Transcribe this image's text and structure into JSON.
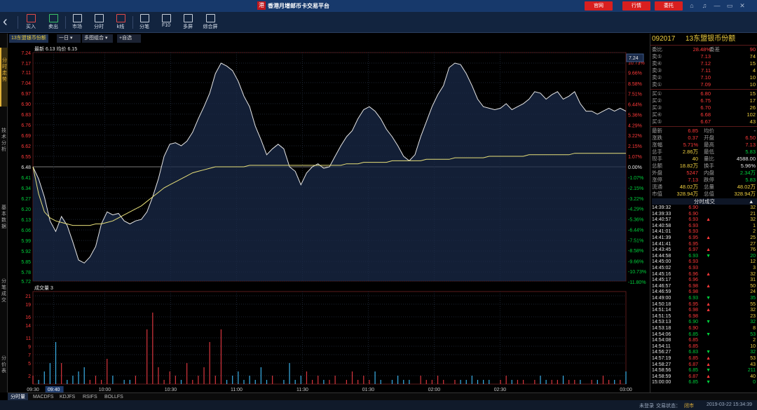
{
  "titlebar": {
    "logo_text": "港",
    "title": "香港月增邮币卡交易平台",
    "buttons": [
      "官网",
      "行情",
      "委托"
    ],
    "win_controls": [
      "⌂",
      "♫",
      "—",
      "▭",
      "✕"
    ]
  },
  "toolbar": {
    "items": [
      {
        "label": "买入",
        "icon": "buy-icon"
      },
      {
        "label": "卖出",
        "icon": "sell-icon"
      },
      {
        "label": "市场",
        "icon": "market-icon"
      },
      {
        "label": "分时",
        "icon": "timeshare-icon"
      },
      {
        "label": "k线",
        "icon": "kline-icon"
      },
      {
        "label": "分笔",
        "icon": "tick-icon"
      },
      {
        "label": "F10",
        "icon": "f10-icon"
      },
      {
        "label": "多屏",
        "icon": "multiscreen-icon"
      },
      {
        "label": "综合屏",
        "icon": "dashboard-icon"
      }
    ]
  },
  "left_tabs": [
    "分时走势",
    "技术分析",
    "基本数据",
    "分笔成交",
    "分价表"
  ],
  "chart_header": {
    "stock_tab": "13东盟银币份额",
    "period": "一日",
    "combo": "多图组合",
    "add_fav": "+自选",
    "info": "最新 6.13  均价 6.15"
  },
  "volume_label": "成交量 3",
  "bottom_tabs": [
    "分时量",
    "MACDFS",
    "KDJFS",
    "RSIFS",
    "BOLLFS"
  ],
  "status": {
    "left": "未登录",
    "trade_state": "交易状态：",
    "closed": "闭市",
    "datetime": "2019-03-22 15:34:39"
  },
  "quote": {
    "code": "092017",
    "name": "13东盟银币份额",
    "weibi": {
      "label": "委比",
      "value": "28.48%",
      "label2": "委差",
      "value2": "90"
    },
    "asks": [
      {
        "label": "卖⑤",
        "price": "7.13",
        "vol": "74"
      },
      {
        "label": "卖④",
        "price": "7.12",
        "vol": "15"
      },
      {
        "label": "卖③",
        "price": "7.11",
        "vol": "4"
      },
      {
        "label": "卖②",
        "price": "7.10",
        "vol": "10"
      },
      {
        "label": "卖①",
        "price": "7.09",
        "vol": "10"
      }
    ],
    "bids": [
      {
        "label": "买①",
        "price": "6.80",
        "vol": "15"
      },
      {
        "label": "买②",
        "price": "6.75",
        "vol": "17"
      },
      {
        "label": "买③",
        "price": "6.70",
        "vol": "26"
      },
      {
        "label": "买④",
        "price": "6.68",
        "vol": "102"
      },
      {
        "label": "买⑤",
        "price": "6.67",
        "vol": "43"
      }
    ],
    "stats": [
      {
        "l1": "最新",
        "v1": "6.85",
        "c1": "red",
        "l2": "均价",
        "v2": "-",
        "c2": "white"
      },
      {
        "l1": "涨跌",
        "v1": "0.37",
        "c1": "red",
        "l2": "开盘",
        "v2": "6.50",
        "c2": "red"
      },
      {
        "l1": "涨幅",
        "v1": "5.71%",
        "c1": "red",
        "l2": "最高",
        "v2": "7.13",
        "c2": "red"
      },
      {
        "l1": "总手",
        "v1": "2.86万",
        "c1": "yellow",
        "l2": "最低",
        "v2": "5.83",
        "c2": "green"
      },
      {
        "l1": "现手",
        "v1": "40",
        "c1": "yellow",
        "l2": "量比",
        "v2": "4588.00",
        "c2": "white"
      },
      {
        "l1": "总额",
        "v1": "18.82万",
        "c1": "yellow",
        "l2": "换手",
        "v2": "5.96%",
        "c2": "white"
      },
      {
        "l1": "外盘",
        "v1": "5247",
        "c1": "red",
        "l2": "内盘",
        "v2": "2.34万",
        "c2": "green"
      },
      {
        "l1": "涨停",
        "v1": "7.13",
        "c1": "red",
        "l2": "跌停",
        "v2": "5.83",
        "c2": "green"
      },
      {
        "l1": "流通",
        "v1": "48.02万",
        "c1": "yellow",
        "l2": "总量",
        "v2": "48.02万",
        "c2": "yellow"
      },
      {
        "l1": "市值",
        "v1": "328.94万",
        "c1": "yellow",
        "l2": "总值",
        "v2": "328.94万",
        "c2": "yellow"
      }
    ],
    "ticks_header": "分时成交",
    "ticks": [
      {
        "t": "14:39:32",
        "p": "6.90",
        "d": "",
        "v": "32"
      },
      {
        "t": "14:39:33",
        "p": "6.90",
        "d": "",
        "v": "21"
      },
      {
        "t": "14:40:57",
        "p": "6.93",
        "d": "up",
        "v": "32"
      },
      {
        "t": "14:40:58",
        "p": "6.93",
        "d": "",
        "v": "1"
      },
      {
        "t": "14:41:01",
        "p": "6.93",
        "d": "",
        "v": "2"
      },
      {
        "t": "14:41:39",
        "p": "6.95",
        "d": "up",
        "v": "25"
      },
      {
        "t": "14:41:41",
        "p": "6.95",
        "d": "",
        "v": "27"
      },
      {
        "t": "14:43:45",
        "p": "6.97",
        "d": "up",
        "v": "76"
      },
      {
        "t": "14:44:58",
        "p": "6.93",
        "d": "down",
        "v": "20"
      },
      {
        "t": "14:45:00",
        "p": "6.93",
        "d": "",
        "v": "12"
      },
      {
        "t": "14:45:02",
        "p": "6.93",
        "d": "",
        "v": "3"
      },
      {
        "t": "14:45:16",
        "p": "6.96",
        "d": "up",
        "v": "32"
      },
      {
        "t": "14:45:17",
        "p": "6.96",
        "d": "",
        "v": "31"
      },
      {
        "t": "14:46:57",
        "p": "6.98",
        "d": "up",
        "v": "50"
      },
      {
        "t": "14:46:59",
        "p": "6.98",
        "d": "",
        "v": "24"
      },
      {
        "t": "14:49:00",
        "p": "6.93",
        "d": "down",
        "v": "35"
      },
      {
        "t": "14:50:18",
        "p": "6.95",
        "d": "up",
        "v": "55"
      },
      {
        "t": "14:51:14",
        "p": "6.98",
        "d": "up",
        "v": "32"
      },
      {
        "t": "14:51:15",
        "p": "6.98",
        "d": "",
        "v": "23"
      },
      {
        "t": "14:53:13",
        "p": "6.90",
        "d": "down",
        "v": "32"
      },
      {
        "t": "14:53:18",
        "p": "6.90",
        "d": "",
        "v": "8"
      },
      {
        "t": "14:54:06",
        "p": "6.85",
        "d": "down",
        "v": "53"
      },
      {
        "t": "14:54:08",
        "p": "6.85",
        "d": "",
        "v": "2"
      },
      {
        "t": "14:54:11",
        "p": "6.85",
        "d": "",
        "v": "10"
      },
      {
        "t": "14:56:27",
        "p": "6.83",
        "d": "down",
        "v": "32"
      },
      {
        "t": "14:57:19",
        "p": "6.85",
        "d": "up",
        "v": "53"
      },
      {
        "t": "14:58:27",
        "p": "6.87",
        "d": "up",
        "v": "43"
      },
      {
        "t": "14:58:56",
        "p": "6.85",
        "d": "down",
        "v": "211"
      },
      {
        "t": "14:58:59",
        "p": "6.87",
        "d": "up",
        "v": "40"
      },
      {
        "t": "15:00:00",
        "p": "6.85",
        "d": "down",
        "v": "0"
      }
    ]
  },
  "chart_data": {
    "type": "line",
    "title": "",
    "x_ticks": [
      "09:30",
      "09:40",
      "10:00",
      "10:30",
      "11:00",
      "11:30",
      "01:30",
      "02:00",
      "02:30",
      "03:00"
    ],
    "price_left_ticks": [
      "7.24",
      "7.17",
      "7.11",
      "7.04",
      "6.97",
      "6.90",
      "6.83",
      "6.76",
      "6.69",
      "6.62",
      "6.55",
      "6.48",
      "6.41",
      "6.34",
      "6.27",
      "6.20",
      "6.13",
      "6.06",
      "5.99",
      "5.92",
      "5.85",
      "5.78",
      "5.72"
    ],
    "price_right_ticks": [
      "10.73%",
      "9.66%",
      "8.58%",
      "7.51%",
      "6.44%",
      "5.36%",
      "4.29%",
      "3.22%",
      "2.15%",
      "1.07%",
      "0.00%",
      "-1.07%",
      "-2.15%",
      "-3.22%",
      "-4.29%",
      "-5.36%",
      "-6.44%",
      "-7.51%",
      "-8.58%",
      "-9.66%",
      "-10.73%",
      "-11.80%"
    ],
    "price_max_box": "7.24",
    "prev_close": 6.48,
    "ylim": [
      5.72,
      7.24
    ],
    "volume_ticks": [
      "21",
      "19",
      "16",
      "14",
      "11",
      "9",
      "7",
      "5",
      "2"
    ],
    "volume_ylim": [
      0,
      22
    ],
    "series": [
      {
        "name": "最新",
        "values": [
          6.48,
          6.4,
          6.28,
          6.12,
          6.05,
          6.15,
          6.09,
          5.98,
          5.86,
          5.84,
          5.88,
          5.95,
          6.1,
          6.18,
          6.16,
          6.17,
          6.12,
          6.1,
          6.12,
          6.13,
          6.18,
          6.28,
          6.4,
          6.55,
          6.63,
          6.64,
          6.62,
          6.65,
          6.71,
          6.8,
          6.88,
          6.97,
          7.1,
          7.17,
          7.15,
          7.12,
          7.05,
          6.95,
          6.88,
          6.75,
          6.66,
          6.56,
          6.6,
          6.63,
          6.6,
          6.48,
          6.45,
          6.36,
          6.44,
          6.48,
          6.5,
          6.47,
          6.48,
          6.55,
          6.62,
          6.68,
          6.72,
          6.8,
          6.86,
          6.88,
          6.85,
          6.8,
          6.73,
          6.68,
          6.62,
          6.55,
          6.52,
          6.56,
          6.68,
          6.78,
          6.88,
          6.96,
          7.02,
          7.14,
          7.17,
          7.16,
          7.1,
          7.02,
          6.93,
          6.88,
          6.87,
          6.86,
          6.87,
          6.9,
          6.86,
          6.88,
          6.9,
          6.93,
          6.98,
          6.97,
          6.93,
          6.96,
          6.98,
          6.93,
          6.95,
          6.98,
          6.9,
          6.85,
          6.85,
          6.83,
          6.85,
          6.87,
          6.85,
          6.87,
          6.85
        ]
      },
      {
        "name": "均价",
        "values": [
          6.48,
          6.3,
          6.18,
          6.14,
          6.12,
          6.11,
          6.1,
          6.09,
          6.09,
          6.09,
          6.09,
          6.1,
          6.1,
          6.11,
          6.12,
          6.14,
          6.16,
          6.18,
          6.2,
          6.22,
          6.25,
          6.28,
          6.31,
          6.34,
          6.36,
          6.38,
          6.4,
          6.42,
          6.44,
          6.45,
          6.46,
          6.47,
          6.48,
          6.48,
          6.48,
          6.48,
          6.48,
          6.48,
          6.49,
          6.49,
          6.49,
          6.49,
          6.49,
          6.49,
          6.49,
          6.49,
          6.49,
          6.49,
          6.49,
          6.49,
          6.49,
          6.49,
          6.49,
          6.49,
          6.49,
          6.5,
          6.5,
          6.5,
          6.51,
          6.51,
          6.51,
          6.51,
          6.51,
          6.52,
          6.52,
          6.52,
          6.52,
          6.52,
          6.52,
          6.53,
          6.53,
          6.53,
          6.53,
          6.53,
          6.54,
          6.54,
          6.54,
          6.54,
          6.54,
          6.54,
          6.55,
          6.55,
          6.55,
          6.55,
          6.55,
          6.55,
          6.55,
          6.56,
          6.56,
          6.56,
          6.56,
          6.56,
          6.56,
          6.56,
          6.56,
          6.57,
          6.57,
          6.57,
          6.57,
          6.57,
          6.57,
          6.57,
          6.57,
          6.57,
          6.57
        ]
      },
      {
        "name": "成交量",
        "values": [
          2,
          1,
          3,
          5,
          10,
          5,
          1,
          2,
          3,
          4,
          1,
          2,
          1,
          6,
          2,
          0,
          1,
          1,
          2,
          0,
          13,
          17,
          4,
          1,
          3,
          2,
          1,
          5,
          1,
          2,
          4,
          10,
          2,
          13,
          1,
          2,
          3,
          1,
          2,
          1,
          4,
          1,
          2,
          0,
          1,
          5,
          1,
          2,
          3,
          1,
          2,
          1,
          1,
          2,
          0,
          1,
          3,
          1,
          2,
          1,
          3,
          1,
          0,
          1,
          2,
          1,
          1,
          0,
          2,
          1,
          1,
          2,
          1,
          0,
          1,
          1,
          1,
          2,
          1,
          1,
          1,
          0,
          1,
          2,
          1,
          1,
          1,
          0,
          1,
          2,
          1,
          1,
          1,
          2,
          1,
          1,
          1,
          0,
          1,
          1,
          2,
          1,
          1,
          1,
          3
        ]
      }
    ]
  }
}
